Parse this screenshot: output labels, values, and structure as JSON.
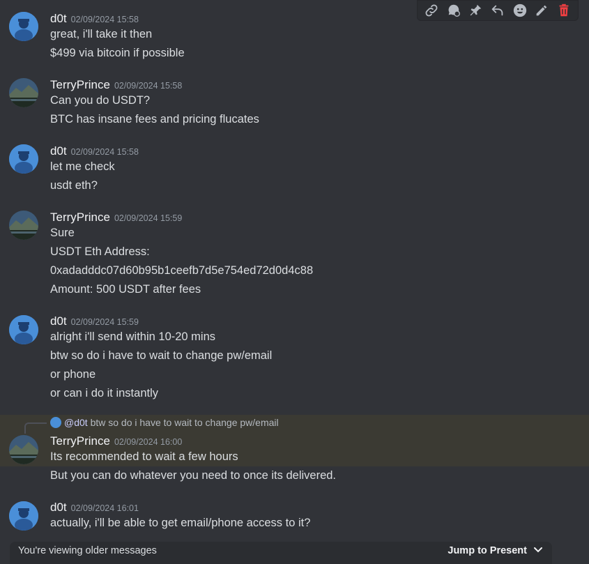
{
  "toolbar": {
    "icons": [
      "link-icon",
      "thread-icon",
      "pin-icon",
      "reply-icon",
      "emoji-icon",
      "edit-icon",
      "delete-icon"
    ],
    "delete_color": "#f23f42"
  },
  "messages": [
    {
      "author": "d0t",
      "timestamp": "02/09/2024 15:58",
      "lines": [
        "great, i'll take it then",
        "$499 via bitcoin if possible"
      ]
    },
    {
      "author": "TerryPrince",
      "timestamp": "02/09/2024 15:58",
      "lines": [
        "Can you do USDT?",
        "BTC has insane fees and pricing flucates"
      ]
    },
    {
      "author": "d0t",
      "timestamp": "02/09/2024 15:58",
      "lines": [
        "let me check",
        "usdt eth?"
      ]
    },
    {
      "author": "TerryPrince",
      "timestamp": "02/09/2024 15:59",
      "lines": [
        "Sure",
        "USDT Eth Address:",
        "0xadadddc07d60b95b1ceefb7d5e754ed72d0d4c88",
        "Amount: 500 USDT after fees"
      ]
    },
    {
      "author": "d0t",
      "timestamp": "02/09/2024 15:59",
      "lines": [
        "alright i'll send within 10-20 mins",
        "btw so do i have to wait to change pw/email",
        "or phone",
        "or can i do it instantly"
      ]
    },
    {
      "author": "TerryPrince",
      "timestamp": "02/09/2024 16:00",
      "reply": {
        "mention": "@d0t",
        "text": "btw so do i have to wait to change pw/email"
      },
      "lines": [
        "Its recommended to wait a few hours",
        "But you can do whatever you need to once its delivered."
      ]
    },
    {
      "author": "d0t",
      "timestamp": "02/09/2024 16:01",
      "lines": [
        "actually, i'll be able to get email/phone access to it?"
      ]
    }
  ],
  "banner": {
    "text": "You're viewing older messages",
    "jump_label": "Jump to Present"
  },
  "colors": {
    "background": "#313338",
    "highlight": "#3b3a33",
    "username": "#f2f3f5",
    "timestamp": "#949ba4"
  }
}
